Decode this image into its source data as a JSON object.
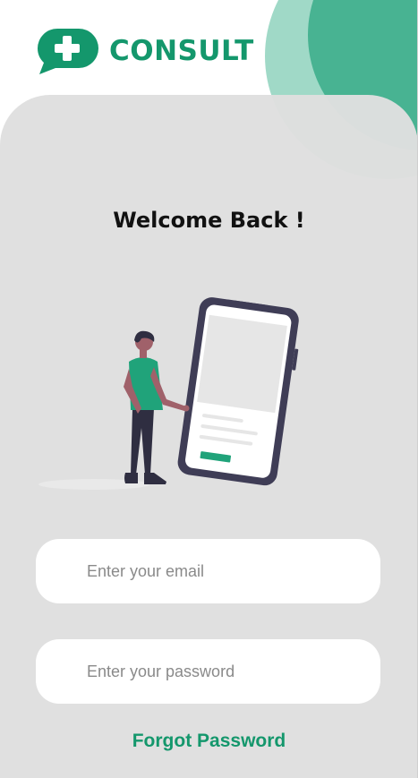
{
  "brand": {
    "name": "CONSULT",
    "logo_icon": "chat-bubble-plus-icon",
    "accent_color": "#14976c"
  },
  "welcome": {
    "title": "Welcome Back !"
  },
  "illustration": {
    "name": "person-with-phone-illustration"
  },
  "login": {
    "email_placeholder": "Enter your email",
    "password_placeholder": "Enter your password",
    "forgot_password": "Forgot Password"
  }
}
